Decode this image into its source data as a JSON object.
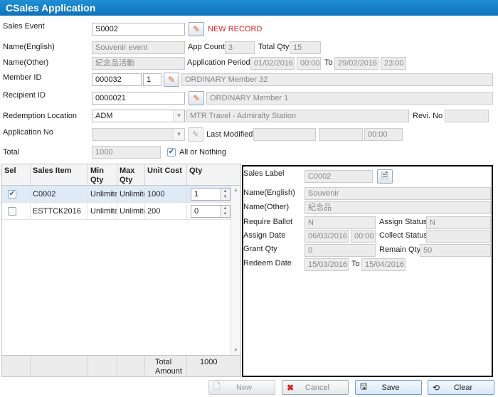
{
  "window": {
    "title": "CSales Application"
  },
  "form": {
    "sales_event_label": "Sales Event",
    "sales_event_value": "S0002",
    "status_text": "NEW RECORD",
    "name_en_label": "Name(English)",
    "name_en_value": "Souvenir event",
    "app_count_label": "App Count",
    "app_count_value": "3",
    "total_qty_label": "Total Qty",
    "total_qty_value": "15",
    "name_other_label": "Name(Other)",
    "name_other_value": "紀念品活動",
    "app_period_label": "Application Period",
    "period_from_date": "01/02/2016",
    "period_from_time": "00:00",
    "to_label": "To",
    "period_to_date": "29/02/2016",
    "period_to_time": "23:00",
    "member_id_label": "Member ID",
    "member_id_value": "000032",
    "member_seq_value": "1",
    "member_name": "ORDINARY Member 32",
    "recipient_id_label": "Recipient ID",
    "recipient_id_value": "0000021",
    "recipient_name": "ORDINARY Member 1",
    "redemption_location_label": "Redemption Location",
    "redemption_location_value": "ADM",
    "redemption_location_name": "MTR Travel - Admiralty Station",
    "revi_no_label": "Revi. No",
    "revi_no_value": "",
    "application_no_label": "Application No",
    "application_no_value": "",
    "last_modified_label": "Last Modified",
    "last_modified_user": "",
    "last_modified_date": "",
    "last_modified_time": "00:00",
    "total_label": "Total",
    "total_value": "1000",
    "all_or_nothing_label": "All or Nothing",
    "all_or_nothing_checked": true
  },
  "grid": {
    "headers": {
      "sel": "Sel",
      "item": "Sales Item",
      "min": "Min Qty",
      "max": "Max Qty",
      "cost": "Unit Cost",
      "qty": "Qty"
    },
    "rows": [
      {
        "checked": true,
        "item": "C0002",
        "min": "Unlimited",
        "max": "Unlimited",
        "cost": "1000",
        "qty": "1"
      },
      {
        "checked": false,
        "item": "ESTTCK2016",
        "min": "Unlimited",
        "max": "Unlimited",
        "cost": "200",
        "qty": "0"
      }
    ],
    "footer": {
      "total_amount_label": "Total Amount",
      "total_amount_value": "1000"
    }
  },
  "detail": {
    "sales_label_label": "Sales Label",
    "sales_label_value": "C0002",
    "name_en_label": "Name(English)",
    "name_en_value": "Souvenir",
    "name_other_label": "Name(Other)",
    "name_other_value": "紀念品",
    "require_ballot_label": "Require Ballot",
    "require_ballot_value": "N",
    "assign_status_label": "Assign Status",
    "assign_status_value": "N",
    "assign_date_label": "Assign Date",
    "assign_date_value": "06/03/2016",
    "assign_time_value": "00:00",
    "collect_status_label": "Collect Status",
    "collect_status_value": "",
    "grant_qty_label": "Grant Qty",
    "grant_qty_value": "0",
    "remain_qty_label": "Remain Qty",
    "remain_qty_value": "50",
    "redeem_date_label": "Redeem Date",
    "redeem_from": "15/03/2016",
    "to_label": "To",
    "redeem_to": "15/04/2016"
  },
  "buttons": {
    "new": "New",
    "cancel": "Cancel",
    "save": "Save",
    "clear": "Clear"
  },
  "icons": {
    "pick": "pencil-pick-icon",
    "doc": "document-icon"
  }
}
